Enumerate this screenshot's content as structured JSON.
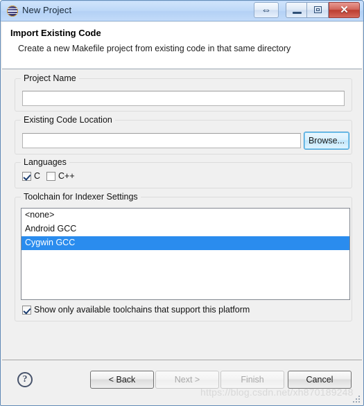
{
  "window": {
    "title": "New Project",
    "app_icon": "eclipse-sphere-icon",
    "controls": {
      "resize": "⇔",
      "minimize": "minimize-icon",
      "maximize": "restore-icon",
      "close": "✕"
    }
  },
  "header": {
    "title": "Import Existing Code",
    "description": "Create a new Makefile project from existing code in that same directory"
  },
  "groups": {
    "project_name": {
      "legend": "Project Name",
      "input_value": "",
      "input_placeholder": ""
    },
    "existing_code_location": {
      "legend": "Existing Code Location",
      "input_value": "",
      "input_placeholder": "",
      "browse_label": "Browse..."
    },
    "languages": {
      "legend": "Languages",
      "options": [
        {
          "label": "C",
          "checked": true
        },
        {
          "label": "C++",
          "checked": false
        }
      ]
    },
    "toolchain": {
      "legend": "Toolchain for Indexer Settings",
      "items": [
        {
          "label": "<none>",
          "selected": false
        },
        {
          "label": "Android GCC",
          "selected": false
        },
        {
          "label": "Cygwin GCC",
          "selected": true
        }
      ],
      "filter_checkbox": {
        "label": "Show only available toolchains that support this platform",
        "checked": true
      }
    }
  },
  "footer": {
    "help_icon": "?",
    "buttons": [
      {
        "label": "< Back",
        "enabled": true,
        "default": false
      },
      {
        "label": "Next >",
        "enabled": false,
        "default": false
      },
      {
        "label": "Finish",
        "enabled": false,
        "default": false
      },
      {
        "label": "Cancel",
        "enabled": true,
        "default": true
      }
    ]
  },
  "watermark": "https://blog.csdn.net/xh870189248",
  "colors": {
    "selection_blue": "#2a8cee",
    "titlebar_blue": "#bdd8f8",
    "close_red": "#bc3d31",
    "focus_blue": "#3c9ad6",
    "panel_gray": "#f0f0f0"
  }
}
